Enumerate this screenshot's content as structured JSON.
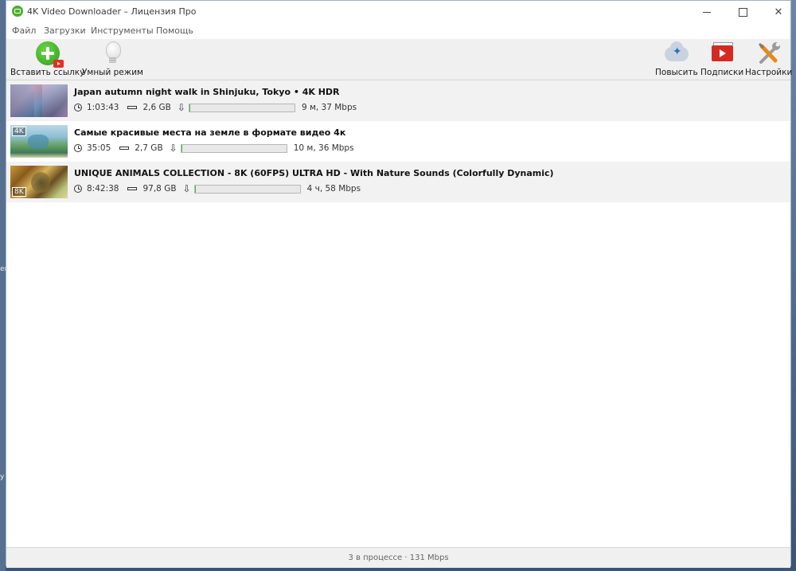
{
  "window": {
    "title": "4K Video Downloader – Лицензия Про",
    "controls": [
      "minimize",
      "maximize",
      "close"
    ]
  },
  "menu": [
    "Файл",
    "Загрузки",
    "Инструменты",
    "Помощь"
  ],
  "toolbar": {
    "paste_label": "Вставить ссылку",
    "smart_label": "Умный режим",
    "upgrade_label": "Повысить",
    "subs_label": "Подписки",
    "settings_label": "Настройки"
  },
  "downloads": [
    {
      "title": "Japan autumn night walk in Shinjuku, Tokyo • 4K HDR",
      "duration": "1:03:43",
      "size": "2,6 GB",
      "progress": 0.01,
      "eta": "9 м, 37 Mbps",
      "thumb_badge": ""
    },
    {
      "title": "Самые красивые места на земле в формате видео 4к",
      "duration": "35:05",
      "size": "2,7 GB",
      "progress": 0.01,
      "eta": "10 м, 36 Mbps",
      "thumb_badge": "4K"
    },
    {
      "title": "UNIQUE ANIMALS COLLECTION - 8K (60FPS) ULTRA HD - With Nature Sounds (Colorfully Dynamic)",
      "duration": "8:42:38",
      "size": "97,8 GB",
      "progress": 0.0,
      "eta": "4 ч, 58 Mbps",
      "thumb_badge": "8K"
    }
  ],
  "status": {
    "text": "3 в процессе · 131 Mbps"
  },
  "desktop": {
    "edge_glyphs": [
      "er",
      "y"
    ]
  },
  "colors": {
    "progress": "#35c23a",
    "accent_red": "#d42a22",
    "paste_green": "#3fae25"
  }
}
